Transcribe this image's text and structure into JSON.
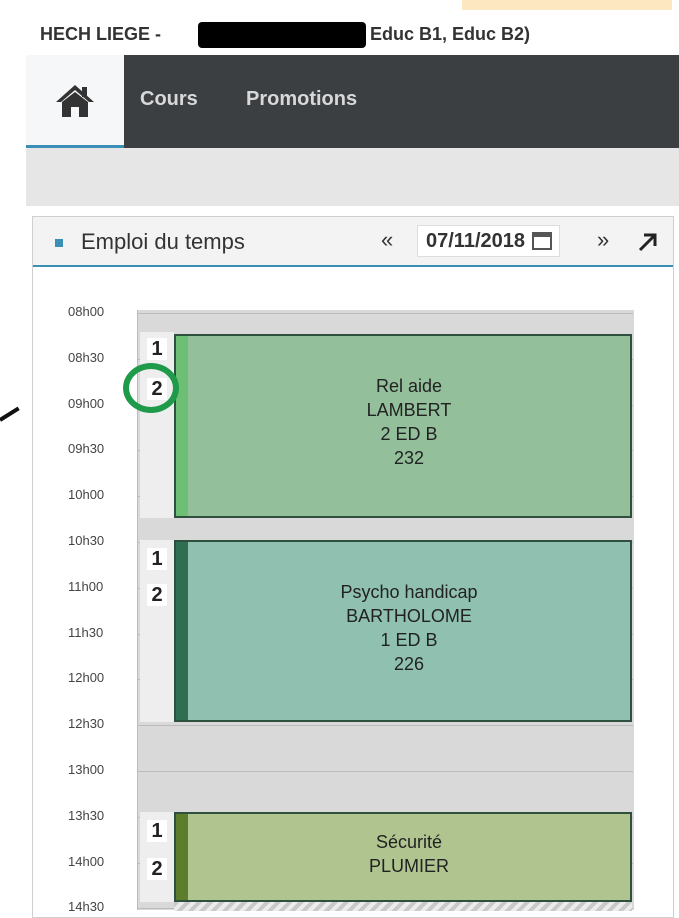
{
  "header": {
    "prefix": "HECH LIEGE -",
    "suffix": "Educ B1, Educ B2)"
  },
  "nav": {
    "home_icon": "home-icon",
    "items": [
      {
        "label": "Cours"
      },
      {
        "label": "Promotions"
      }
    ]
  },
  "panel": {
    "title": "Emploi du temps",
    "date": "07/11/2018",
    "icons": [
      "double-left-arrow-icon",
      "calendar-icon",
      "double-right-arrow-icon",
      "expand-arrow-icon"
    ]
  },
  "times": [
    "08h00",
    "08h30",
    "09h00",
    "09h30",
    "10h00",
    "10h30",
    "11h00",
    "11h30",
    "12h00",
    "12h30",
    "13h00",
    "13h30",
    "14h00",
    "14h30"
  ],
  "courses": [
    {
      "groups": [
        "1",
        "2"
      ],
      "name": "Rel aide",
      "teacher": "LAMBERT",
      "class": "2 ED B",
      "room": "232",
      "color": "#93c09b",
      "stripe": "#6dbf75"
    },
    {
      "groups": [
        "1",
        "2"
      ],
      "name": "Psycho handicap",
      "teacher": "BARTHOLOME",
      "class": "1 ED B",
      "room": "226",
      "color": "#8fc0b0",
      "stripe": "#2e6f52"
    },
    {
      "groups": [
        "1",
        "2"
      ],
      "name": "Sécurité",
      "teacher": "PLUMIER",
      "color": "#b0c48f",
      "stripe": "#5c7d2c"
    }
  ],
  "colors": {
    "accent": "#3a8fb7",
    "highlight_circle": "#1f9a4a",
    "nav_bg": "#3c3f42"
  }
}
